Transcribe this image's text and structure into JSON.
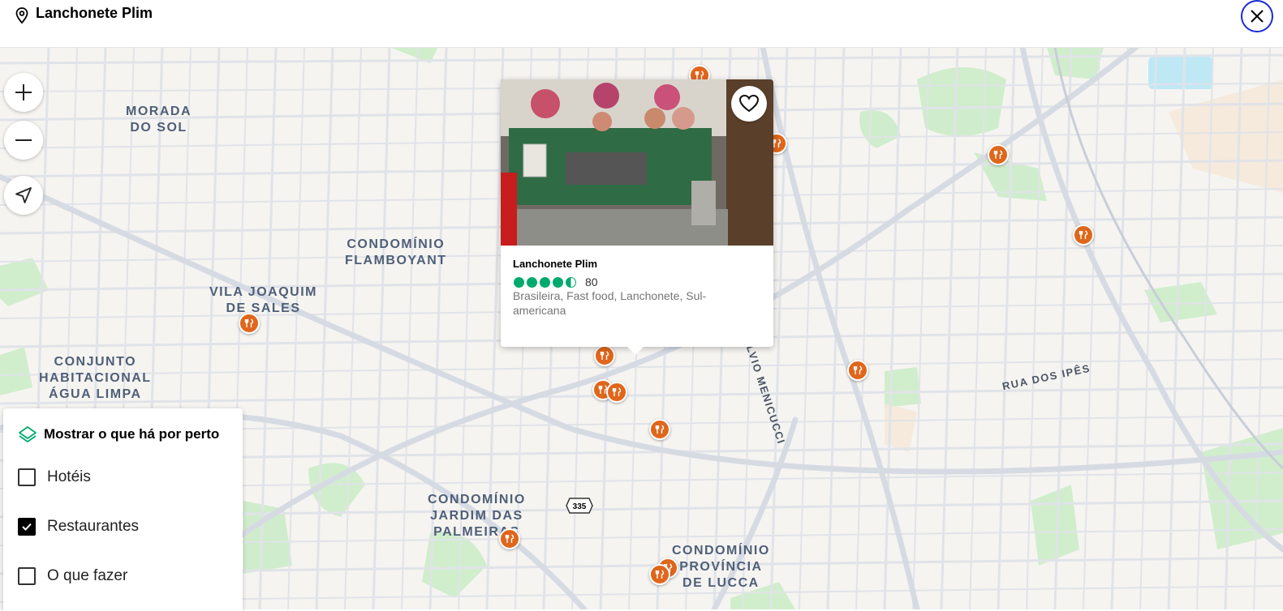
{
  "header": {
    "title": "Lanchonete Plim",
    "pin_icon": "map-pin-icon",
    "close_icon": "close-icon"
  },
  "map": {
    "neighborhoods": [
      {
        "id": "morada",
        "text": "MORADA\nDO SOL"
      },
      {
        "id": "flamboyant",
        "text": "CONDOMÍNIO\nFLAMBOYANT"
      },
      {
        "id": "vila",
        "text": "VILA JOAQUIM\nDE SALES"
      },
      {
        "id": "conjunto",
        "text": "CONJUNTO\nHABITACIONAL\nÁGUA LIMPA"
      },
      {
        "id": "jardim",
        "text": "CONDOMÍNIO\nJARDIM DAS\nPALMEIRAS"
      },
      {
        "id": "lucca",
        "text": "CONDOMÍNIO\nPROVÍNCIA\nDE LUCCA"
      }
    ],
    "streets": {
      "avenida": "IDA DOUTOR SÍLVIO MENICUCCI",
      "ipes": "RUA DOS IPÊS"
    },
    "route_shield": "335"
  },
  "controls": {
    "zoom_in": "+",
    "zoom_out": "−",
    "locate": "locate-icon"
  },
  "popup": {
    "name": "Lanchonete Plim",
    "rating": 4.5,
    "review_count": "80",
    "cuisine": "Brasileira, Fast food, Lanchonete, Sul-americana",
    "favorite_icon": "heart-icon"
  },
  "filters": {
    "title": "Mostrar o que há por perto",
    "options": [
      {
        "label": "Hotéis",
        "checked": false
      },
      {
        "label": "Restaurantes",
        "checked": true
      },
      {
        "label": "O que fazer",
        "checked": false
      }
    ]
  },
  "colors": {
    "accent": "#e0661b",
    "rating": "#00aa6c",
    "close_ring": "#1a2bd6"
  }
}
